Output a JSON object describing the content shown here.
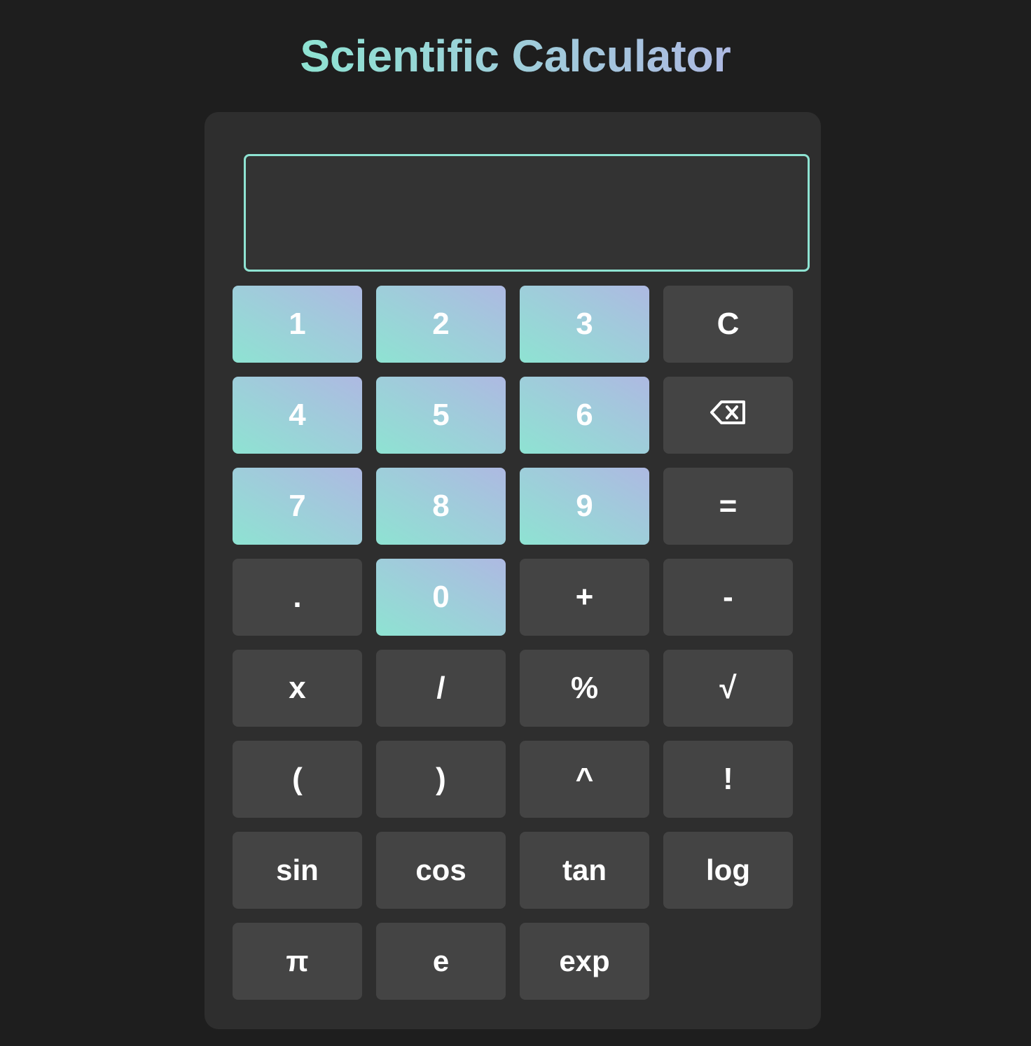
{
  "title": "Scientific Calculator",
  "display": {
    "value": ""
  },
  "colors": {
    "background": "#1e1e1e",
    "panel": "#2e2e2e",
    "key": "#444444",
    "accent_start": "#8ee3d2",
    "accent_end": "#aeb9e2"
  },
  "keys": [
    {
      "label": "1",
      "kind": "num",
      "name": "key-1"
    },
    {
      "label": "2",
      "kind": "num",
      "name": "key-2"
    },
    {
      "label": "3",
      "kind": "num",
      "name": "key-3"
    },
    {
      "label": "C",
      "kind": "op",
      "name": "clear-button"
    },
    {
      "label": "4",
      "kind": "num",
      "name": "key-4"
    },
    {
      "label": "5",
      "kind": "num",
      "name": "key-5"
    },
    {
      "label": "6",
      "kind": "num",
      "name": "key-6"
    },
    {
      "label": "",
      "kind": "backspace",
      "icon": "backspace-icon",
      "name": "backspace-button"
    },
    {
      "label": "7",
      "kind": "num",
      "name": "key-7"
    },
    {
      "label": "8",
      "kind": "num",
      "name": "key-8"
    },
    {
      "label": "9",
      "kind": "num",
      "name": "key-9"
    },
    {
      "label": "=",
      "kind": "op",
      "name": "equals-button"
    },
    {
      "label": ".",
      "kind": "op",
      "name": "decimal-button"
    },
    {
      "label": "0",
      "kind": "num",
      "name": "key-0"
    },
    {
      "label": "+",
      "kind": "op",
      "name": "add-button"
    },
    {
      "label": "-",
      "kind": "op",
      "name": "subtract-button"
    },
    {
      "label": "x",
      "kind": "op",
      "name": "multiply-button"
    },
    {
      "label": "/",
      "kind": "op",
      "name": "divide-button"
    },
    {
      "label": "%",
      "kind": "op",
      "name": "percent-button"
    },
    {
      "label": "√",
      "kind": "op",
      "name": "sqrt-button"
    },
    {
      "label": "(",
      "kind": "op",
      "name": "open-paren-button"
    },
    {
      "label": ")",
      "kind": "op",
      "name": "close-paren-button"
    },
    {
      "label": "^",
      "kind": "op",
      "name": "power-button"
    },
    {
      "label": "!",
      "kind": "op",
      "name": "factorial-button"
    },
    {
      "label": "sin",
      "kind": "fn",
      "name": "sin-button"
    },
    {
      "label": "cos",
      "kind": "fn",
      "name": "cos-button"
    },
    {
      "label": "tan",
      "kind": "fn",
      "name": "tan-button"
    },
    {
      "label": "log",
      "kind": "fn",
      "name": "log-button"
    },
    {
      "label": "π",
      "kind": "fn",
      "name": "pi-button"
    },
    {
      "label": "e",
      "kind": "fn",
      "name": "e-button"
    },
    {
      "label": "exp",
      "kind": "fn",
      "name": "exp-button"
    }
  ]
}
